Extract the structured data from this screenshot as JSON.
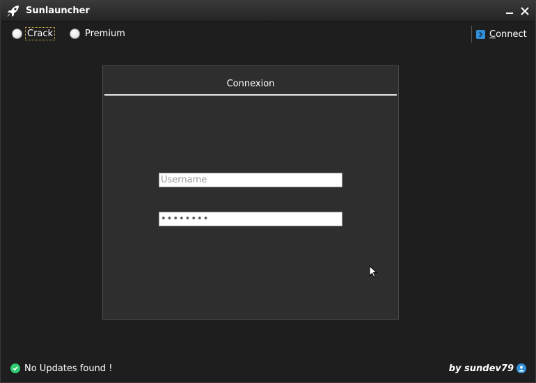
{
  "window": {
    "title": "Sunlauncher"
  },
  "mode": {
    "options": [
      {
        "label": "Crack",
        "selected": false,
        "focused": true
      },
      {
        "label": "Premium",
        "selected": false,
        "focused": false
      }
    ]
  },
  "toolbar": {
    "connect_label": "Connect",
    "connect_icon": "chevron-right-icon"
  },
  "login": {
    "title": "Connexion",
    "username_placeholder": "Username",
    "username_value": "",
    "password_value": "password"
  },
  "status": {
    "text": "No Updates found !",
    "icon": "check-circle-icon",
    "color": "#2ecc71"
  },
  "credit": {
    "text": "by  sundev79",
    "icon": "user-icon"
  },
  "colors": {
    "accent": "#2f8fd8",
    "background": "#1e1e1e",
    "panel": "#2e2e2e"
  }
}
